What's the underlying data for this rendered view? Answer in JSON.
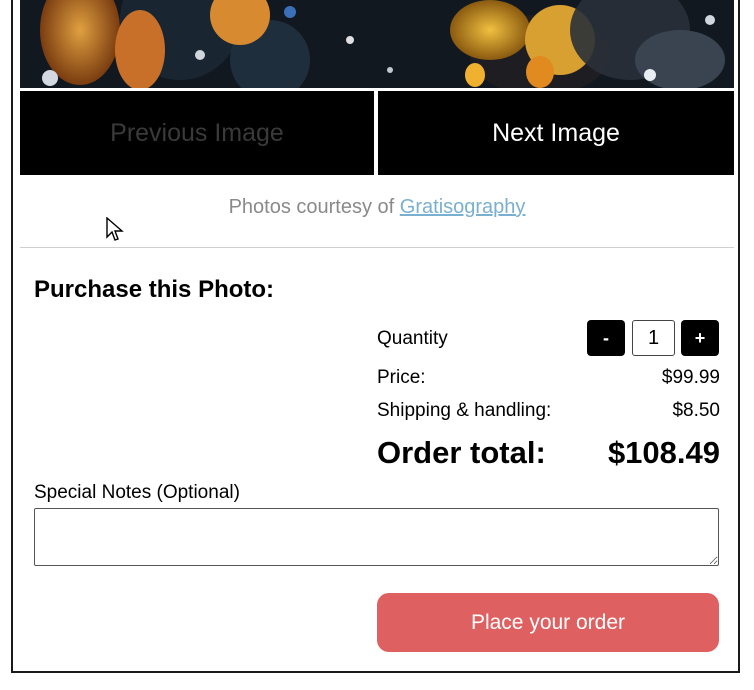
{
  "gallery": {
    "prev_label": "Previous Image",
    "next_label": "Next Image",
    "credit_prefix": "Photos courtesy of",
    "credit_link": "Gratisography"
  },
  "purchase": {
    "heading": "Purchase this Photo:",
    "quantity_label": "Quantity",
    "decrement_label": "-",
    "increment_label": "+",
    "quantity_value": "1",
    "price_label": "Price:",
    "price_value": "$99.99",
    "shipping_label": "Shipping & handling:",
    "shipping_value": "$8.50",
    "total_label": "Order total:",
    "total_value": "$108.49",
    "notes_label": "Special Notes (Optional)",
    "notes_value": "",
    "order_button": "Place your order"
  },
  "colors": {
    "order_button": "#de6060",
    "credit_link": "#7ab0cf",
    "nav_background": "#000000"
  }
}
